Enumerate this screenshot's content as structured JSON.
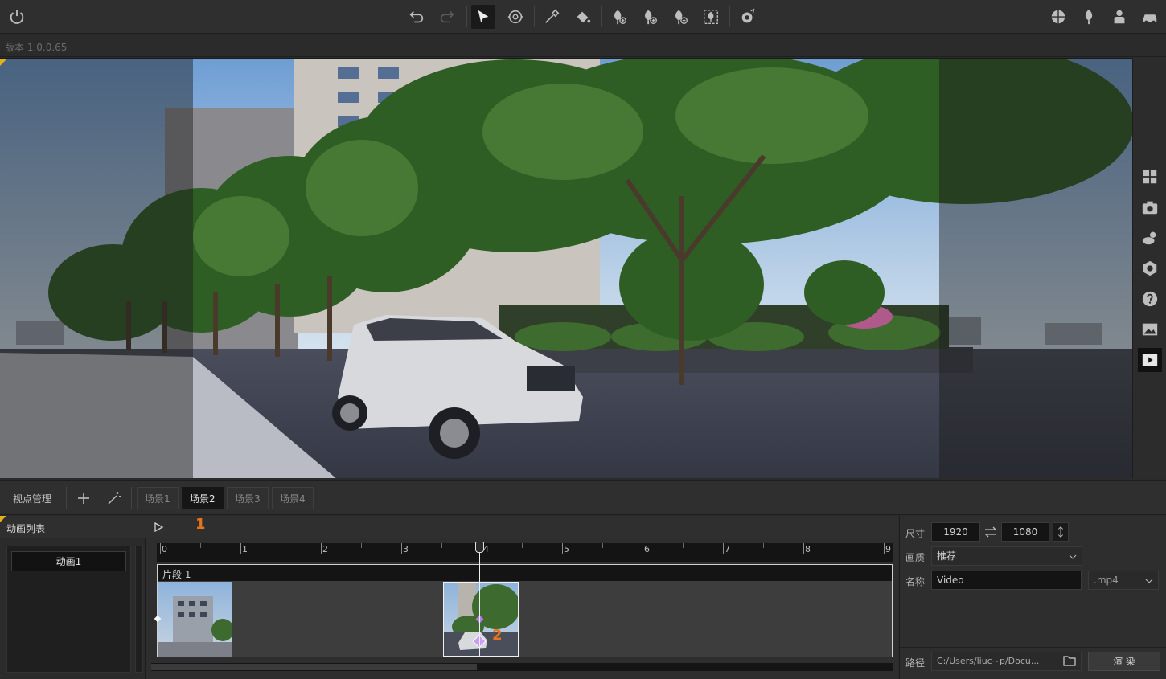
{
  "version_label": "版本 1.0.0.65",
  "toolbar": {
    "power": "power-icon",
    "undo": "undo-icon",
    "redo": "redo-icon",
    "select": "select-arrow-icon",
    "orbit": "orbit-icon",
    "picker": "eyedropper-icon",
    "paint": "paint-bucket-icon",
    "tree_add1": "plant-add-icon",
    "tree_add2": "plant-add-alt-icon",
    "tree_remove": "plant-remove-icon",
    "tree_group": "plant-group-icon",
    "brush": "brush-icon",
    "globe": "globe-icon",
    "plant_right": "plant-icon",
    "person": "person-icon",
    "car": "car-icon"
  },
  "rightbar": [
    "grid-icon",
    "camera-icon",
    "weather-icon",
    "settings-icon",
    "help-icon",
    "image-icon",
    "play-icon"
  ],
  "scenebar": {
    "manage_label": "视点管理",
    "tabs": [
      {
        "label": "场景1",
        "active": false
      },
      {
        "label": "场景2",
        "active": true
      },
      {
        "label": "场景3",
        "active": false
      },
      {
        "label": "场景4",
        "active": false
      }
    ]
  },
  "animation_list": {
    "title": "动画列表",
    "items": [
      "动画1"
    ]
  },
  "timeline": {
    "marker_1": "1",
    "marker_2": "2",
    "ticks": [
      "0",
      "1",
      "2",
      "3",
      "4",
      "5",
      "6",
      "7",
      "8",
      "9"
    ],
    "segment_label": "片段 1",
    "playhead_value": 4
  },
  "props": {
    "size_label": "尺寸",
    "width": "1920",
    "height": "1080",
    "quality_label": "画质",
    "quality_value": "推荐",
    "name_label": "名称",
    "name_value": "Video",
    "ext_value": ".mp4",
    "path_label": "路径",
    "path_value": "C:/Users/liuc~p/Docu...",
    "render_label": "渲 染"
  },
  "colors": {
    "accent_orange": "#e8741a",
    "keyframe_purple": "#b57cf0"
  }
}
